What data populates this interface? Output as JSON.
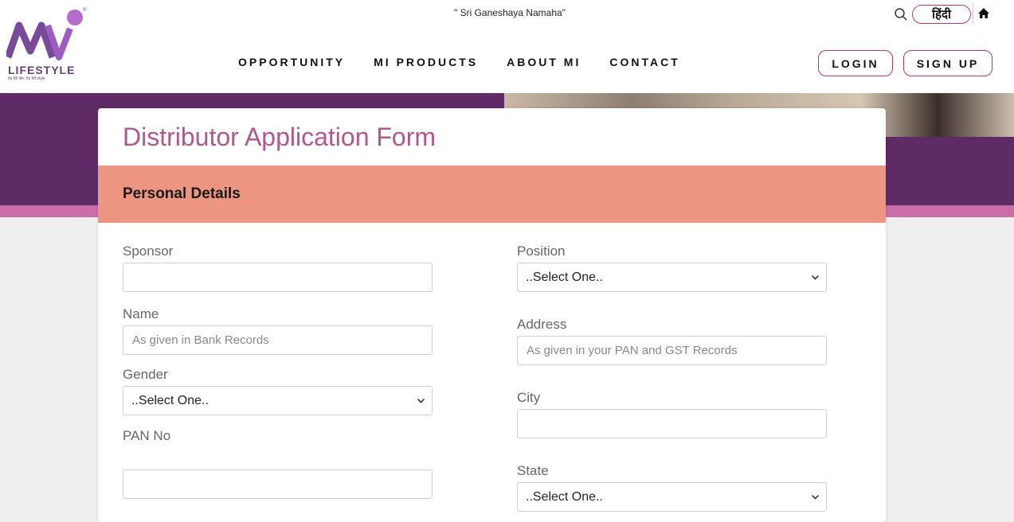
{
  "header": {
    "tagline": "\" Sri Ganeshaya Namaha\"",
    "logo_text": "LIFESTYLE",
    "logo_sub": "Its MI life. Its MI style",
    "nav": [
      "OPPORTUNITY",
      "MI PRODUCTS",
      "ABOUT MI",
      "CONTACT"
    ],
    "lang_label": "हिंदी",
    "login_label": "LOGIN",
    "signup_label": "SIGN UP",
    "icons": {
      "search": "search-icon",
      "home": "home-icon"
    }
  },
  "form": {
    "title": "Distributor Application Form",
    "section": "Personal Details",
    "fields": {
      "sponsor": {
        "label": "Sponsor",
        "value": "",
        "placeholder": ""
      },
      "name": {
        "label": "Name",
        "value": "",
        "placeholder": "As given in Bank Records"
      },
      "gender": {
        "label": "Gender",
        "selected": "..Select One.."
      },
      "pan": {
        "label": "PAN No",
        "value": "",
        "placeholder": ""
      },
      "position": {
        "label": "Position",
        "selected": "..Select One.."
      },
      "address": {
        "label": "Address",
        "value": "",
        "placeholder": "As given in your PAN and GST Records"
      },
      "city": {
        "label": "City",
        "value": "",
        "placeholder": ""
      },
      "state": {
        "label": "State",
        "selected": "..Select One.."
      }
    }
  },
  "colors": {
    "brand_purple": "#5e2b66",
    "title_pink": "#b2578e",
    "section_salmon": "#ec9581",
    "accent_band": "#c96ea6"
  }
}
